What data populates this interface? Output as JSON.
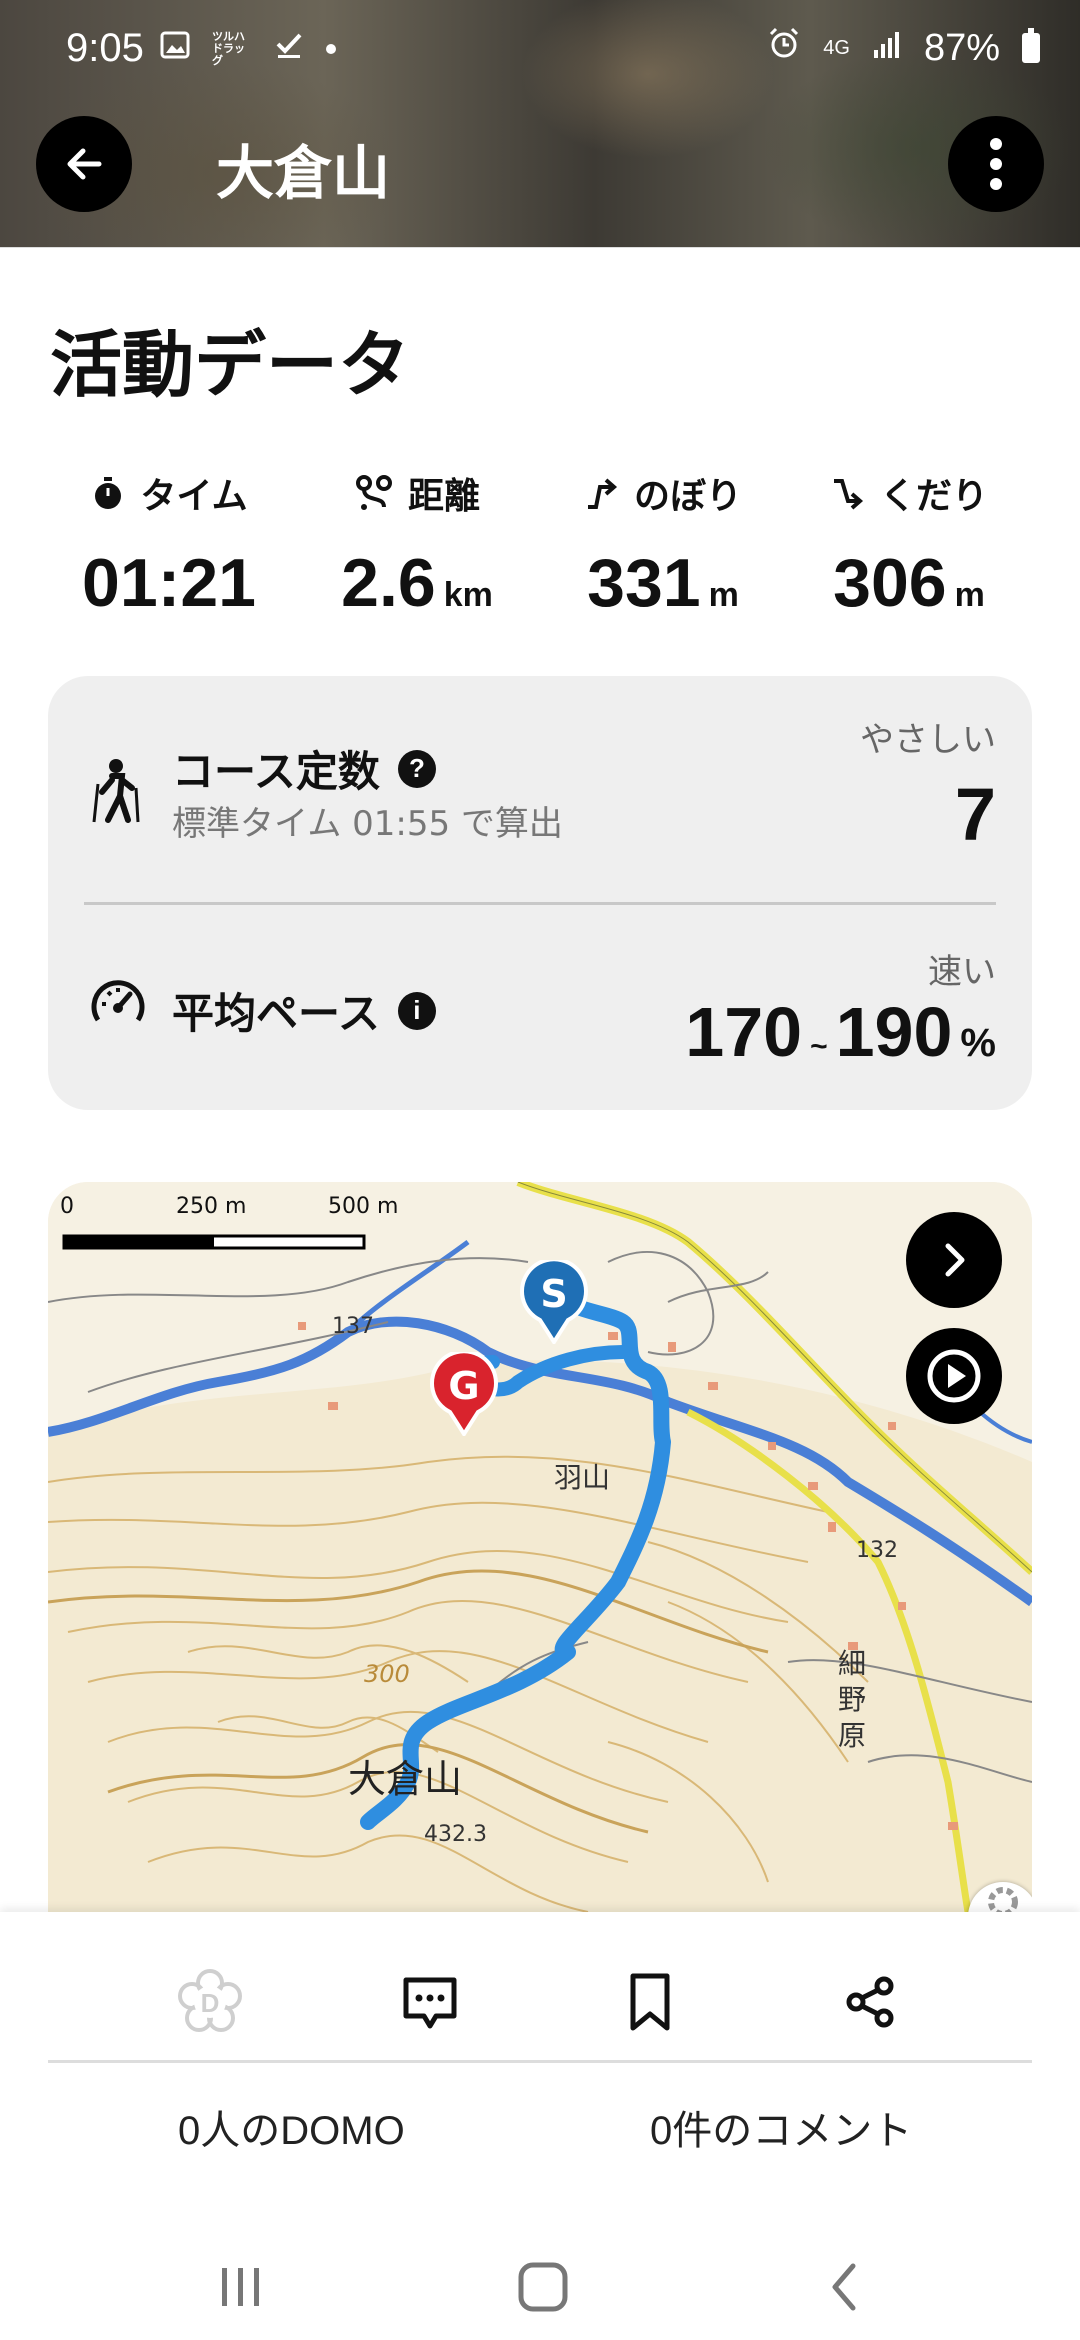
{
  "status_bar": {
    "time": "9:05",
    "small_text": "ツルハ ドラッグ",
    "network": "4G",
    "battery": "87%"
  },
  "header": {
    "title": "大倉山"
  },
  "activity": {
    "section_title": "活動データ",
    "stats": [
      {
        "label": "タイム",
        "value": "01:21",
        "unit": "",
        "icon": "stopwatch-icon"
      },
      {
        "label": "距離",
        "value": "2.6",
        "unit": "km",
        "icon": "route-icon"
      },
      {
        "label": "のぼり",
        "value": "331",
        "unit": "m",
        "icon": "ascent-icon"
      },
      {
        "label": "くだり",
        "value": "306",
        "unit": "m",
        "icon": "descent-icon"
      }
    ]
  },
  "course": {
    "title": "コース定数",
    "subtitle": "標準タイム 01:55 で算出",
    "rating": "やさしい",
    "value": "7"
  },
  "pace": {
    "title": "平均ペース",
    "rating": "速い",
    "value_low": "170",
    "separator": "~",
    "value_high": "190",
    "unit": "%"
  },
  "map": {
    "scale_labels": [
      "0",
      "250 m",
      "500 m"
    ],
    "place_labels": [
      "137",
      "羽山",
      "132",
      "細",
      "野",
      "原",
      "300",
      "大倉山",
      "432.3",
      "0"
    ],
    "start_marker": "S",
    "goal_marker": "G",
    "colors": {
      "route": "#2f8ee0",
      "road": "#e8e04a",
      "river": "#4a7fd6",
      "contour": "#d9b877",
      "start": "#1f6fb5",
      "goal": "#d9232d"
    }
  },
  "actions": {
    "domo_count": "0人のDOMO",
    "comment_count": "0件のコメント"
  }
}
